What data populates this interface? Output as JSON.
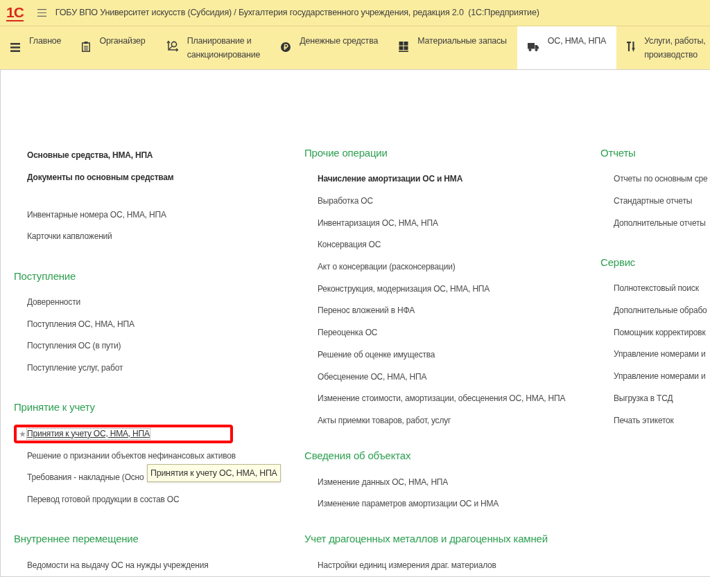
{
  "title_bar": {
    "logo": "1С",
    "title": "ГОБУ ВПО Университет искусств (Субсидия) / Бухгалтерия государственного учреждения, редакция 2.0  (1С:Предприятие)"
  },
  "sections_panel": {
    "tabs": [
      {
        "label": "Главное",
        "selected": false
      },
      {
        "label": "Органайзер",
        "selected": false
      },
      {
        "label": "Планирование и\nсанкционирование",
        "selected": false
      },
      {
        "label": "Денежные средства",
        "selected": false
      },
      {
        "label": "Материальные запасы",
        "selected": false
      },
      {
        "label": "ОС, НМА, НПА",
        "selected": true
      },
      {
        "label": "Услуги, работы,\nпроизводство",
        "selected": false
      }
    ]
  },
  "columns": [
    {
      "groups": [
        {
          "items": [
            {
              "label": "Основные средства, НМА, НПА",
              "important": true
            },
            {
              "label": "Документы по основным средствам",
              "important": true
            }
          ]
        },
        {
          "items": [
            {
              "label": "Инвентарные номера ОС, НМА, НПА"
            },
            {
              "label": "Карточки капвложений"
            }
          ]
        },
        {
          "heading": "Поступление",
          "items": [
            {
              "label": "Доверенности"
            },
            {
              "label": "Поступления ОС, НМА, НПА"
            },
            {
              "label": "Поступления ОС (в пути)"
            },
            {
              "label": "Поступление услуг, работ"
            }
          ]
        },
        {
          "heading": "Принятие к учету",
          "items": [
            {
              "label": "Принятия к учету ОС, НМА, НПА",
              "hovered": true,
              "highlighted": true
            },
            {
              "label": "Решение о признании объектов нефинансовых активов",
              "hovered": false,
              "highlighted": false
            },
            {
              "label": "Требования - накладные (Осно",
              "hovered": false,
              "highlighted": false
            },
            {
              "label": "Перевод готовой продукции в состав ОС",
              "hovered": false,
              "highlighted": false
            }
          ]
        },
        {
          "heading": "Внутреннее перемещение",
          "items": [
            {
              "label": "Ведомости на выдачу ОС на нужды учреждения"
            }
          ]
        }
      ]
    },
    {
      "groups": [
        {
          "heading": "Прочие операции",
          "items": [
            {
              "label": "Начисление амортизации ОС и НМА",
              "important": true
            },
            {
              "label": "Выработка ОС",
              "important": false
            },
            {
              "label": "Инвентаризация ОС, НМА, НПА",
              "important": false
            },
            {
              "label": "Консервация ОС",
              "important": false
            },
            {
              "label": "Акт о консервации (расконсервации)",
              "important": false
            },
            {
              "label": "Реконструкция, модернизация ОС, НМА, НПА",
              "important": false
            },
            {
              "label": "Перенос вложений в НФА",
              "important": false
            },
            {
              "label": "Переоценка ОС",
              "important": false
            },
            {
              "label": "Решение об оценке имущества",
              "important": false
            },
            {
              "label": "Обесценение ОС, НМА, НПА",
              "important": false
            },
            {
              "label": "Изменение стоимости, амортизации, обесценения ОС, НМА, НПА",
              "important": false
            },
            {
              "label": "Акты приемки товаров, работ, услуг",
              "important": false
            }
          ]
        },
        {
          "heading": "Сведения об объектах",
          "items": [
            {
              "label": "Изменение данных ОС, НМА, НПА"
            },
            {
              "label": "Изменение параметров амортизации ОС и НМА"
            }
          ]
        },
        {
          "heading": "Учет драгоценных металлов и драгоценных камней",
          "items": [
            {
              "label": "Настройки единиц измерения драг. материалов"
            }
          ]
        }
      ]
    },
    {
      "groups": [
        {
          "heading": "Отчеты",
          "items": [
            {
              "label": "Отчеты по основным сре"
            },
            {
              "label": "Стандартные отчеты"
            },
            {
              "label": "Дополнительные отчеты"
            }
          ]
        },
        {
          "heading": "Сервис",
          "items": [
            {
              "label": "Полнотекстовый поиск"
            },
            {
              "label": "Дополнительные обрабо"
            },
            {
              "label": "Помощник корректировк"
            },
            {
              "label": "Управление номерами и"
            },
            {
              "label": "Управление номерами и"
            },
            {
              "label": "Выгрузка в ТСД"
            },
            {
              "label": "Печать этикеток"
            }
          ]
        }
      ]
    }
  ],
  "tooltip": {
    "text": "Принятия к учету ОС, НМА, НПА"
  }
}
